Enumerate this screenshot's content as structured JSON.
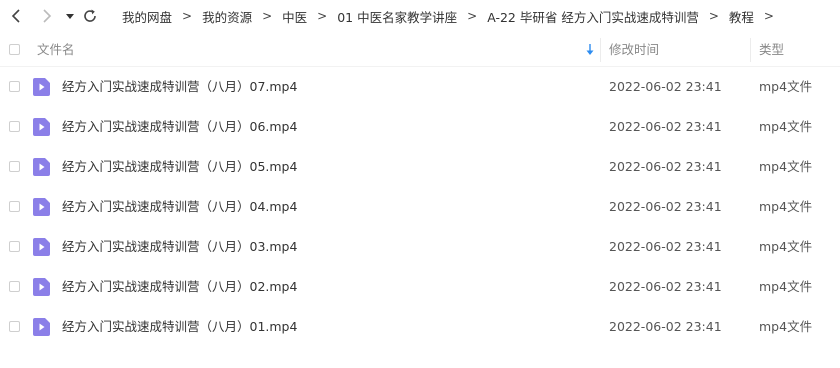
{
  "breadcrumb": [
    "我的网盘",
    "我的资源",
    "中医",
    "01 中医名家教学讲座",
    "A-22 毕研省 经方入门实战速成特训营",
    "教程"
  ],
  "breadcrumb_separator": ">",
  "header": {
    "name": "文件名",
    "modified": "修改时间",
    "type": "类型"
  },
  "colors": {
    "file_icon": "#8b7fe8",
    "sort_arrow": "#2d8cf0"
  },
  "files": [
    {
      "name": "经方入门实战速成特训营（八月）07.mp4",
      "modified": "2022-06-02 23:41",
      "type": "mp4文件"
    },
    {
      "name": "经方入门实战速成特训营（八月）06.mp4",
      "modified": "2022-06-02 23:41",
      "type": "mp4文件"
    },
    {
      "name": "经方入门实战速成特训营（八月）05.mp4",
      "modified": "2022-06-02 23:41",
      "type": "mp4文件"
    },
    {
      "name": "经方入门实战速成特训营（八月）04.mp4",
      "modified": "2022-06-02 23:41",
      "type": "mp4文件"
    },
    {
      "name": "经方入门实战速成特训营（八月）03.mp4",
      "modified": "2022-06-02 23:41",
      "type": "mp4文件"
    },
    {
      "name": "经方入门实战速成特训营（八月）02.mp4",
      "modified": "2022-06-02 23:41",
      "type": "mp4文件"
    },
    {
      "name": "经方入门实战速成特训营（八月）01.mp4",
      "modified": "2022-06-02 23:41",
      "type": "mp4文件"
    }
  ]
}
